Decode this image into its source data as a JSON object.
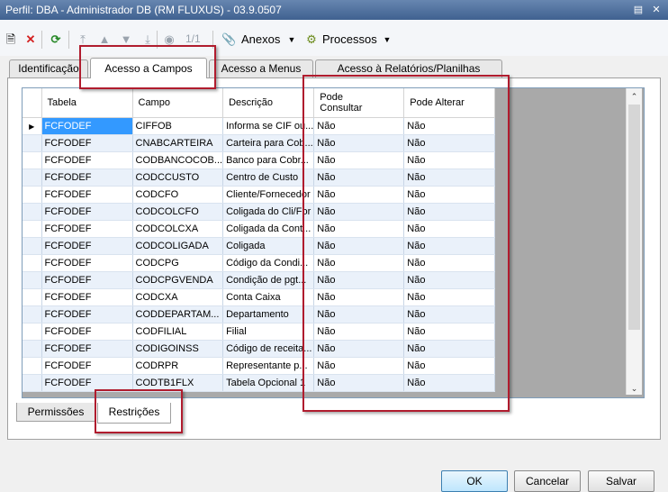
{
  "window": {
    "title": "Perfil: DBA - Administrador DB (RM FLUXUS) - 03.9.0507"
  },
  "toolbar": {
    "record_position": "1/1",
    "anexos_label": "Anexos",
    "processos_label": "Processos"
  },
  "tabs": [
    {
      "label": "Identificação"
    },
    {
      "label": "Acesso a Campos",
      "active": true
    },
    {
      "label": "Acesso a Menus"
    },
    {
      "label": "Acesso à Relatórios/Planilhas"
    }
  ],
  "grid": {
    "columns": [
      "Tabela",
      "Campo",
      "Descrição",
      "Pode\nConsultar",
      "Pode Alterar"
    ],
    "rows": [
      [
        "FCFODEF",
        "CIFFOB",
        "Informa se CIF ou...",
        "Não",
        "Não"
      ],
      [
        "FCFODEF",
        "CNABCARTEIRA",
        "Carteira para Cob...",
        "Não",
        "Não"
      ],
      [
        "FCFODEF",
        "CODBANCOCOB...",
        "Banco para Cobr...",
        "Não",
        "Não"
      ],
      [
        "FCFODEF",
        "CODCCUSTO",
        "Centro de Custo",
        "Não",
        "Não"
      ],
      [
        "FCFODEF",
        "CODCFO",
        "Cliente/Fornecedor",
        "Não",
        "Não"
      ],
      [
        "FCFODEF",
        "CODCOLCFO",
        "Coligada do Cli/For",
        "Não",
        "Não"
      ],
      [
        "FCFODEF",
        "CODCOLCXA",
        "Coligada da Cont...",
        "Não",
        "Não"
      ],
      [
        "FCFODEF",
        "CODCOLIGADA",
        "Coligada",
        "Não",
        "Não"
      ],
      [
        "FCFODEF",
        "CODCPG",
        "Código da Condi...",
        "Não",
        "Não"
      ],
      [
        "FCFODEF",
        "CODCPGVENDA",
        "Condição de pgt...",
        "Não",
        "Não"
      ],
      [
        "FCFODEF",
        "CODCXA",
        "Conta Caixa",
        "Não",
        "Não"
      ],
      [
        "FCFODEF",
        "CODDEPARTAM...",
        "Departamento",
        "Não",
        "Não"
      ],
      [
        "FCFODEF",
        "CODFILIAL",
        "Filial",
        "Não",
        "Não"
      ],
      [
        "FCFODEF",
        "CODIGOINSS",
        "Código de receita...",
        "Não",
        "Não"
      ],
      [
        "FCFODEF",
        "CODRPR",
        "Representante p...",
        "Não",
        "Não"
      ],
      [
        "FCFODEF",
        "CODTB1FLX",
        "Tabela Opcional 1",
        "Não",
        "Não"
      ]
    ]
  },
  "bottom_tabs": [
    {
      "label": "Permissões"
    },
    {
      "label": "Restrições",
      "active": true
    }
  ],
  "buttons": {
    "ok": "OK",
    "cancel": "Cancelar",
    "save": "Salvar"
  },
  "colors": {
    "selection": "#3399ff",
    "highlight_box": "#b01c2e",
    "title_bar": "#4e6f99"
  }
}
